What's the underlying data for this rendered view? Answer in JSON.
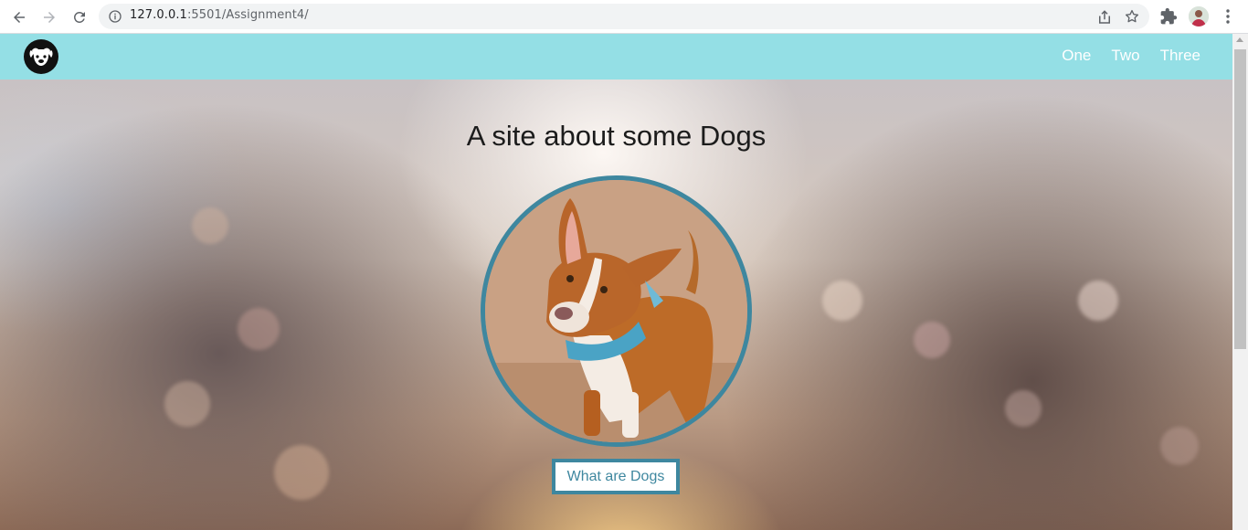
{
  "browser": {
    "url_host": "127.0.0.1",
    "url_rest": ":5501/Assignment4/"
  },
  "navbar": {
    "links": [
      {
        "label": "One"
      },
      {
        "label": "Two"
      },
      {
        "label": "Three"
      }
    ]
  },
  "hero": {
    "title": "A site about some Dogs",
    "button_label": "What are Dogs"
  },
  "colors": {
    "navbar_bg": "#94dfe5",
    "accent": "#3e879f",
    "nav_text": "#ffffff"
  },
  "icons": [
    "back-icon",
    "forward-icon",
    "reload-icon",
    "info-icon",
    "share-icon",
    "star-icon",
    "extensions-icon",
    "menu-icon",
    "dog-logo-icon"
  ]
}
